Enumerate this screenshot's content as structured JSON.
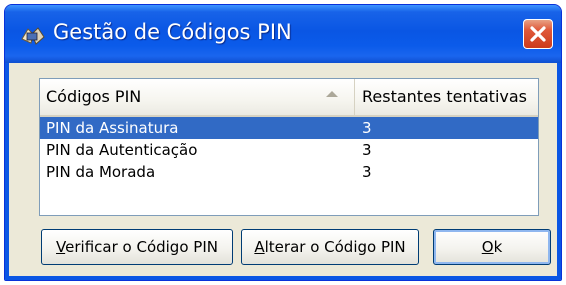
{
  "window": {
    "title": "Gestão de Códigos PIN",
    "title_icon": "hands-cards-icon",
    "close_icon": "close-icon"
  },
  "list": {
    "columns": [
      "Códigos PIN",
      "Restantes tentativas"
    ],
    "sort_icon": "sort-ascending-icon",
    "rows": [
      {
        "name": "PIN da Assinatura",
        "attempts": "3",
        "selected": true
      },
      {
        "name": "PIN da Autenticação",
        "attempts": "3",
        "selected": false
      },
      {
        "name": "PIN da Morada",
        "attempts": "3",
        "selected": false
      }
    ]
  },
  "buttons": {
    "verify": {
      "mnemonic": "V",
      "rest": "erificar o Código PIN"
    },
    "change": {
      "mnemonic": "A",
      "rest": "lterar o Código PIN"
    },
    "ok": {
      "mnemonic": "O",
      "rest": "k"
    }
  },
  "colors": {
    "titlebar": "#0a56e4",
    "selection": "#316ac5",
    "close": "#e0593a",
    "dialog_bg": "#ece9d8"
  }
}
